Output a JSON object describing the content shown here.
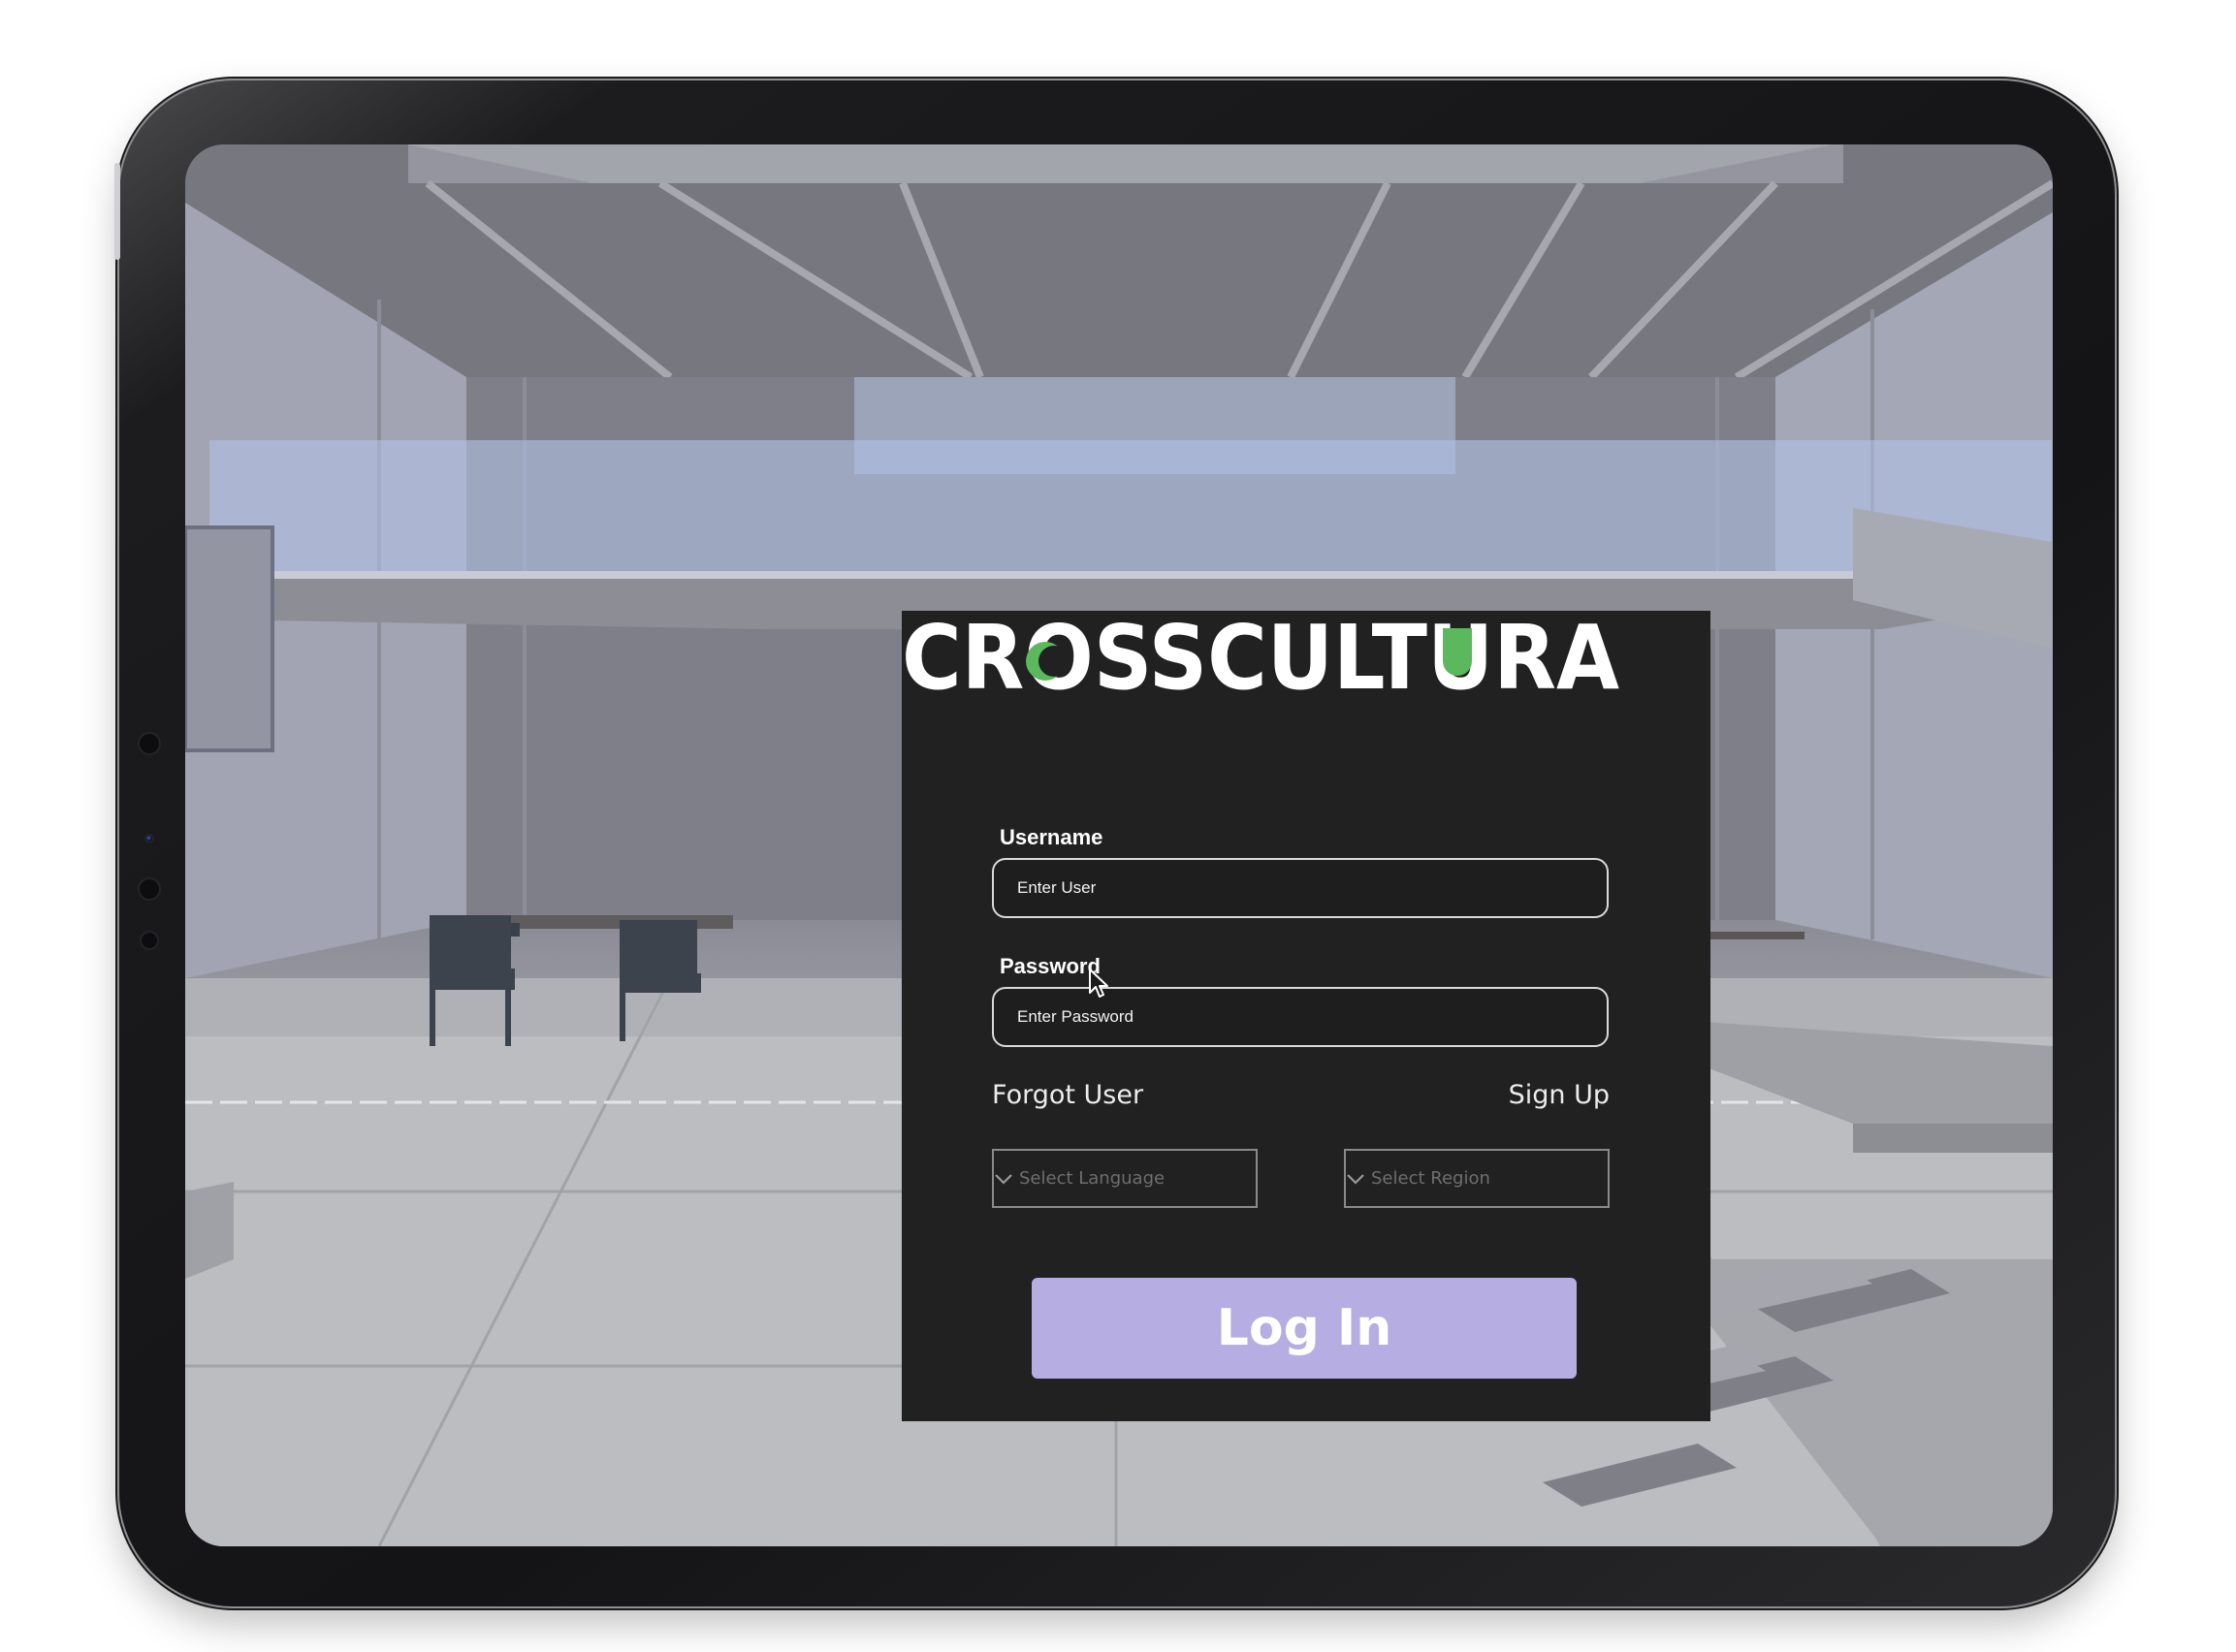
{
  "brand": {
    "name": "CROSSCULTURA",
    "accent_color": "#5cb85c",
    "text_color": "#ffffff"
  },
  "login": {
    "username_label": "Username",
    "username_placeholder": "Enter User",
    "password_label": "Password",
    "password_placeholder": "Enter Password",
    "forgot_user": "Forgot User",
    "sign_up": "Sign Up",
    "language_select": "Select Language",
    "region_select": "Select Region",
    "login_button": "Log In",
    "button_color": "#b6ade3",
    "panel_color": "#212121"
  },
  "background": {
    "description_icon": "3d-office-interior"
  }
}
